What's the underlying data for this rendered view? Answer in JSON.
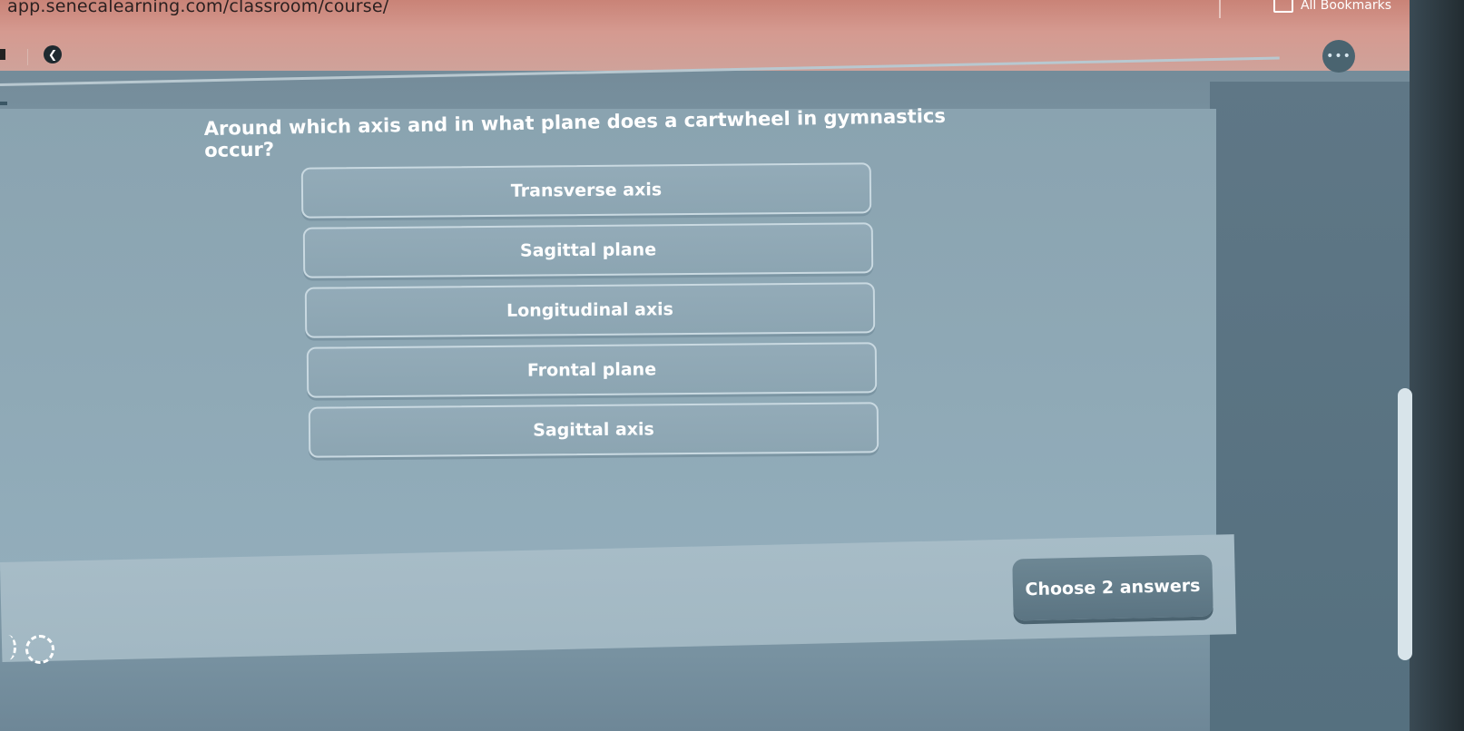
{
  "browser": {
    "url": "app.senecalearning.com/classroom/course/",
    "bookmarks_label": "All Bookmarks",
    "more_label": "•••"
  },
  "quiz": {
    "question": "Around which axis and in what plane does a cartwheel in gymnastics occur?",
    "options": [
      {
        "label": "Transverse axis"
      },
      {
        "label": "Sagittal plane"
      },
      {
        "label": "Longitudinal axis"
      },
      {
        "label": "Frontal plane"
      },
      {
        "label": "Sagittal axis"
      }
    ],
    "choose_label": "Choose 2 answers"
  },
  "colors": {
    "accent": "#5b7482",
    "card_bg": "#8fa9b6",
    "chrome": "#d59a90"
  },
  "icons": {
    "folder": "folder-icon",
    "back": "back-icon",
    "loader": "loading-icon"
  }
}
